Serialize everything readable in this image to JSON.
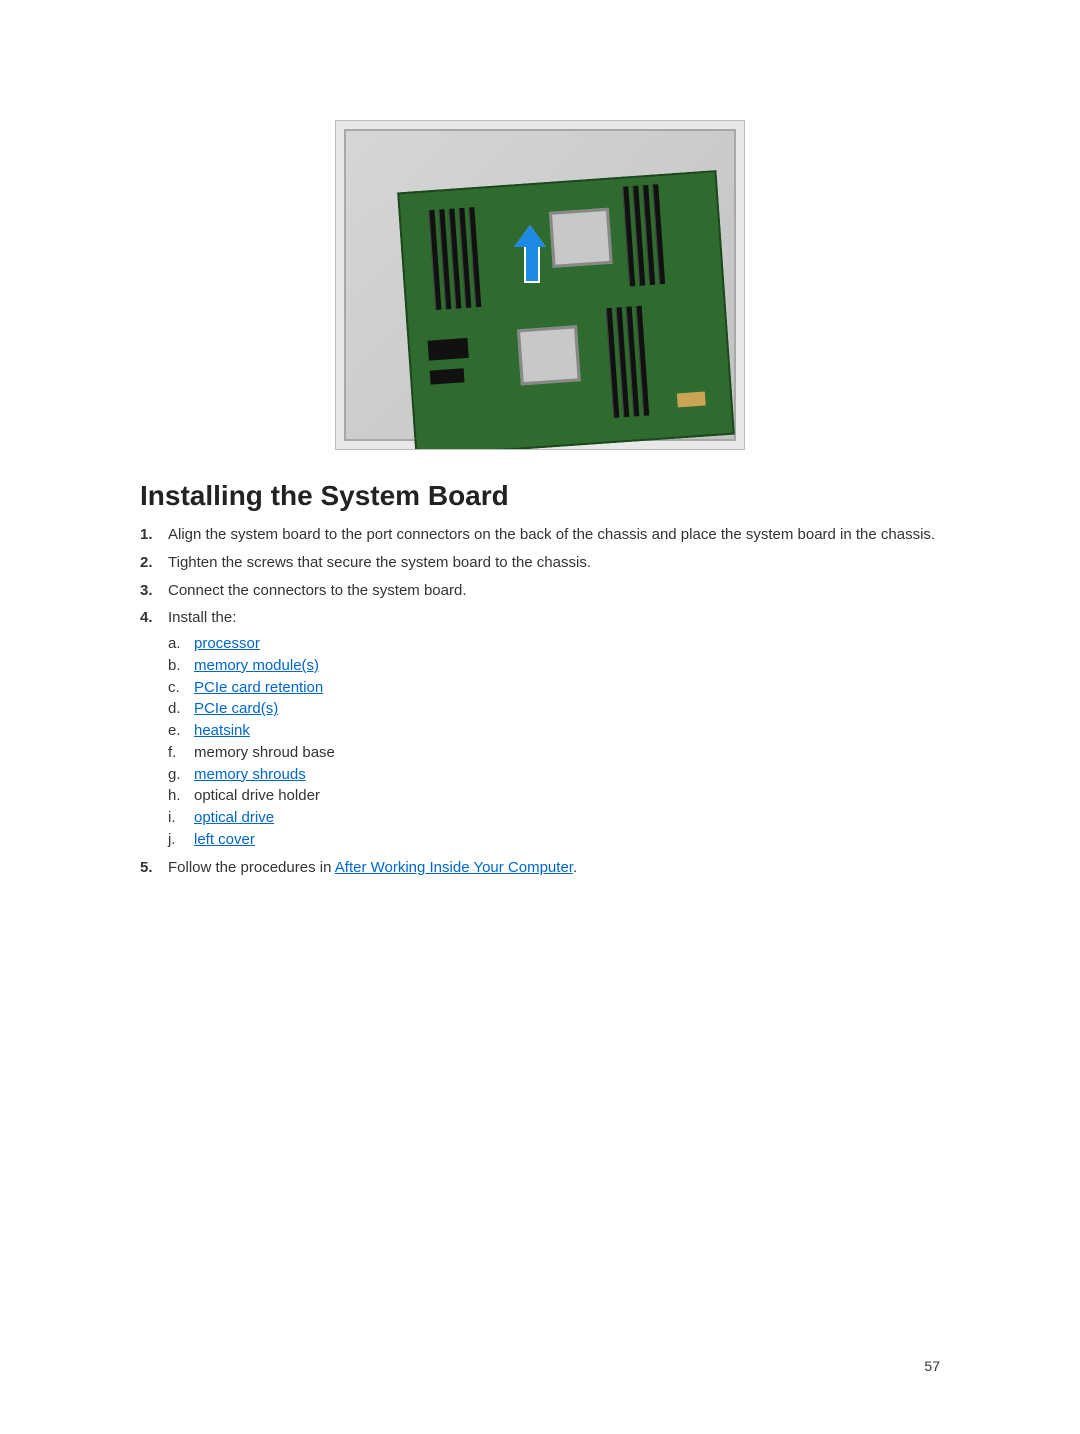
{
  "heading": "Installing the System Board",
  "steps": [
    {
      "text": "Align the system board to the port connectors on the back of the chassis and place the system board in the chassis."
    },
    {
      "text": "Tighten the screws that secure the system board to the chassis."
    },
    {
      "text": "Connect the connectors to the system board."
    },
    {
      "text": "Install the:",
      "subitems": [
        {
          "text": "processor",
          "link": true
        },
        {
          "text": "memory module(s)",
          "link": true
        },
        {
          "text": "PCIe card retention",
          "link": true
        },
        {
          "text": "PCIe card(s)",
          "link": true
        },
        {
          "text": "heatsink",
          "link": true
        },
        {
          "text": "memory shroud base",
          "link": false
        },
        {
          "text": "memory shrouds",
          "link": true
        },
        {
          "text": "optical drive holder",
          "link": false
        },
        {
          "text": "optical drive",
          "link": true
        },
        {
          "text": "left cover",
          "link": true
        }
      ]
    },
    {
      "text_prefix": "Follow the procedures in ",
      "link_text": "After Working Inside Your Computer",
      "text_suffix": "."
    }
  ],
  "page_number": "57",
  "figure_alt": "System board inside chassis with upward arrow indicating installation direction"
}
